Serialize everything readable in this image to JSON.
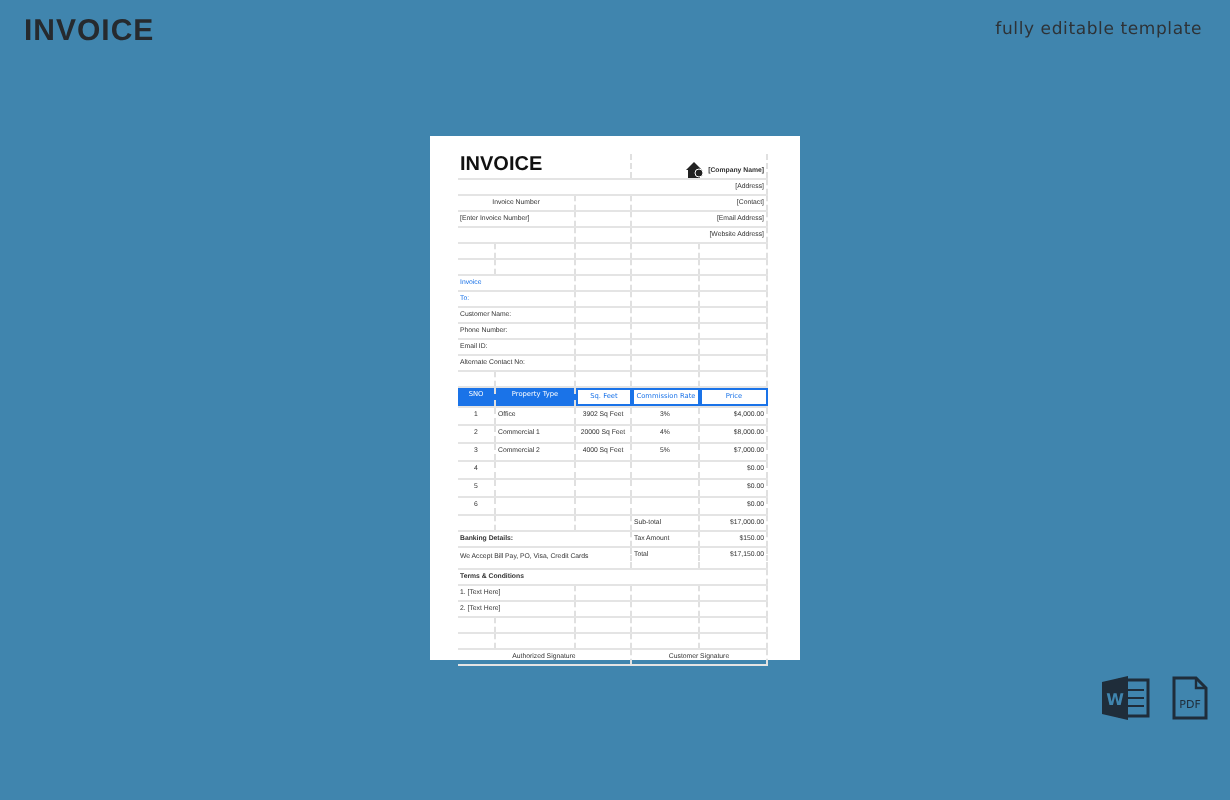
{
  "header": {
    "title": "INVOICE",
    "tagline": "fully editable template"
  },
  "document": {
    "title": "INVOICE",
    "company": [
      "[Company Name]",
      "[Address]",
      "[Contact]",
      "[Email Address]",
      "[Website Address]"
    ],
    "invoice_number_label": "Invoice Number",
    "invoice_number_placeholder": "[Enter Invoice Number]",
    "bill_to_label": [
      "Invoice",
      "To:"
    ],
    "customer_fields": [
      "Customer Name:",
      "Phone Number:",
      "Email ID:",
      "Alternate Contact No:"
    ],
    "table": {
      "columns": [
        {
          "label": "SNO",
          "kind": "filled"
        },
        {
          "label": "Property Type",
          "kind": "filled"
        },
        {
          "label": "Sq. Feet",
          "kind": "outline"
        },
        {
          "label": "Commission Rate",
          "kind": "outline"
        },
        {
          "label": "Price",
          "kind": "outline"
        }
      ],
      "rows": [
        [
          "1",
          "Office",
          "3902 Sq Feet",
          "3%",
          "$4,000.00"
        ],
        [
          "2",
          "Commercial 1",
          "20000 Sq Feet",
          "4%",
          "$8,000.00"
        ],
        [
          "3",
          "Commercial 2",
          "4000 Sq Feet",
          "5%",
          "$7,000.00"
        ],
        [
          "4",
          "",
          "",
          "",
          "$0.00"
        ],
        [
          "5",
          "",
          "",
          "",
          "$0.00"
        ],
        [
          "6",
          "",
          "",
          "",
          "$0.00"
        ]
      ]
    },
    "subtotal": {
      "label": "Sub-total",
      "value": "$17,000.00"
    },
    "tax": {
      "label": "Tax Amount",
      "value": "$150.00"
    },
    "total": {
      "label": "Total",
      "value": "$17,150.00"
    },
    "banking": {
      "title": "Banking Details:",
      "text": "We Accept Bill Pay, PO, Visa, Credit Cards"
    },
    "terms": {
      "title": "Terms & Conditions",
      "items": [
        "1. [Text Here]",
        "2. [Text Here]"
      ]
    },
    "signatures": [
      "Authorized Signature",
      "Customer Signature"
    ]
  },
  "formats": [
    {
      "kind": "word",
      "label": "W"
    },
    {
      "kind": "pdf",
      "label": "PDF"
    }
  ]
}
